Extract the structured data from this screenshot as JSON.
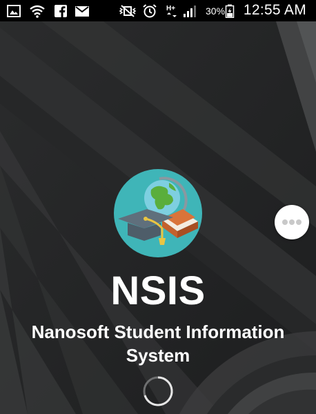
{
  "status_bar": {
    "icons": [
      "gallery-icon",
      "wifi-icon",
      "facebook-icon",
      "gmail-icon",
      "vibrate-mute-icon",
      "alarm-icon",
      "hplus-data-icon",
      "signal-icon",
      "battery-icon"
    ],
    "battery_percent": "30%",
    "time": "12:55 AM"
  },
  "splash": {
    "app_name": "NSIS",
    "subtitle": "Nanosoft Student Information System",
    "logo_icon": "graduation-globe-logo-icon"
  },
  "floating_button": {
    "icon": "more-dots-icon"
  },
  "colors": {
    "background": "#222324",
    "status_bar": "#000000",
    "text": "#ffffff",
    "logo_circle": "#3fb5b8"
  }
}
